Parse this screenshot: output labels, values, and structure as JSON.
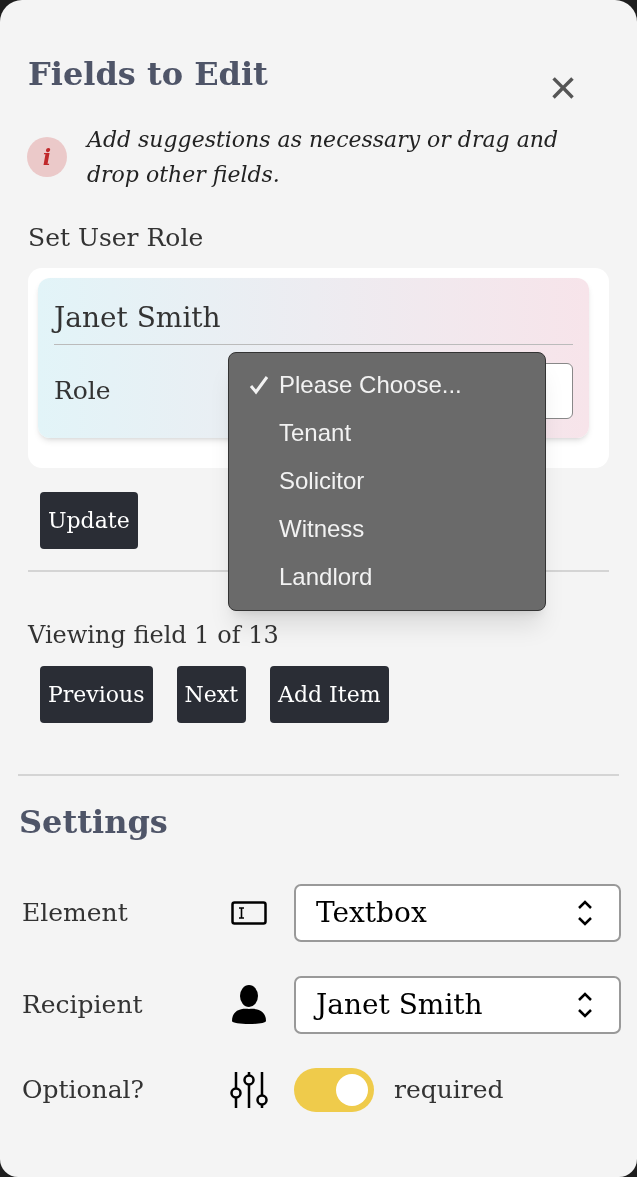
{
  "panel": {
    "title": "Fields to Edit",
    "close": "×"
  },
  "info": {
    "icon": "i",
    "text": "Add suggestions as necessary or drag and drop other fields."
  },
  "user_role": {
    "heading": "Set User Role",
    "name": "Janet Smith",
    "role_label": "Role",
    "role_menu": [
      {
        "label": "Please Choose...",
        "selected": true
      },
      {
        "label": "Tenant",
        "selected": false
      },
      {
        "label": "Solicitor",
        "selected": false
      },
      {
        "label": "Witness",
        "selected": false
      },
      {
        "label": "Landlord",
        "selected": false
      }
    ],
    "update_button": "Update"
  },
  "navigation": {
    "status": "Viewing field 1 of 13",
    "buttons": [
      "Previous",
      "Next",
      "Add Item"
    ]
  },
  "settings": {
    "heading": "Settings",
    "rows": [
      {
        "kind": "select",
        "label": "Element",
        "value": "Textbox"
      },
      {
        "kind": "select",
        "label": "Recipient",
        "value": "Janet Smith"
      },
      {
        "kind": "toggle",
        "label": "Optional?",
        "on": true,
        "text": "required"
      }
    ]
  }
}
